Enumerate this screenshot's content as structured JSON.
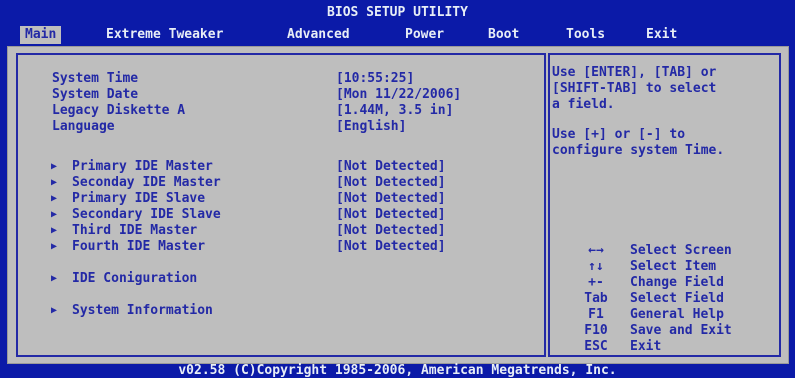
{
  "title": "BIOS SETUP UTILITY",
  "menu": [
    "Main",
    "Extreme Tweaker",
    "Advanced",
    "Power",
    "Boot",
    "Tools",
    "Exit"
  ],
  "settings": [
    {
      "label": "System Time",
      "value": "[10:55:25]"
    },
    {
      "label": "System Date",
      "value": "[Mon 11/22/2006]"
    },
    {
      "label": "Legacy Diskette A",
      "value": "[1.44M, 3.5 in]"
    },
    {
      "label": "Language",
      "value": "[English]"
    }
  ],
  "ide_devices": [
    {
      "label": "Primary IDE Master",
      "value": "[Not Detected]"
    },
    {
      "label": "Seconday IDE Master",
      "value": "[Not Detected]"
    },
    {
      "label": "Primary IDE Slave",
      "value": "[Not Detected]"
    },
    {
      "label": "Secondary IDE Slave",
      "value": "[Not Detected]"
    },
    {
      "label": "Third IDE Master",
      "value": "[Not Detected]"
    },
    {
      "label": "Fourth IDE Master",
      "value": "[Not Detected]"
    }
  ],
  "submenus": [
    "IDE Coniguration",
    "System Information"
  ],
  "help": {
    "text1": "Use [ENTER], [TAB] or\n[SHIFT-TAB] to select\na field.",
    "text2": "Use [+] or [-] to\nconfigure system Time."
  },
  "legend": [
    {
      "key": "←→",
      "text": "Select Screen"
    },
    {
      "key": "↑↓",
      "text": "Select Item"
    },
    {
      "key": "+-",
      "text": "Change Field"
    },
    {
      "key": "Tab",
      "text": "Select Field"
    },
    {
      "key": "F1",
      "text": "General Help"
    },
    {
      "key": "F10",
      "text": "Save and Exit"
    },
    {
      "key": "ESC",
      "text": "Exit"
    }
  ],
  "footer": "v02.58 (C)Copyright 1985-2006, American Megatrends, Inc.",
  "colors": {
    "background": "#0b1aa8",
    "panel": "#bebebe",
    "text": "#2329a6",
    "header_text": "#e8eef6"
  }
}
